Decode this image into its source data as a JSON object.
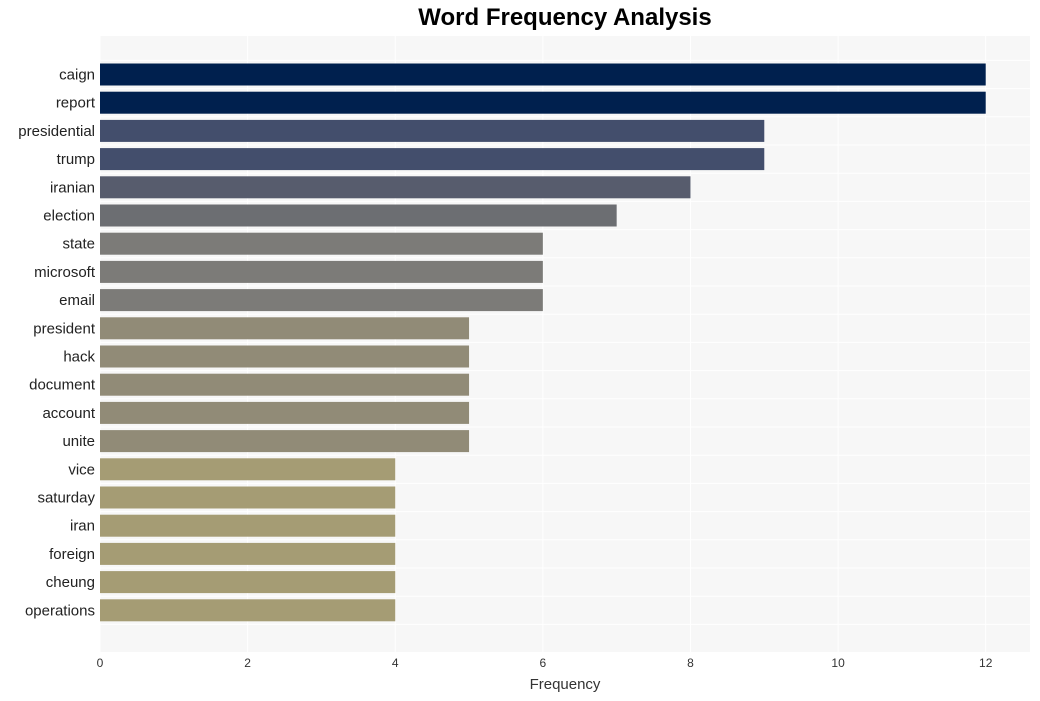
{
  "chart_data": {
    "type": "bar",
    "orientation": "horizontal",
    "title": "Word Frequency Analysis",
    "xlabel": "Frequency",
    "ylabel": "",
    "xlim": [
      0,
      12.6
    ],
    "xticks": [
      0,
      2,
      4,
      6,
      8,
      10,
      12
    ],
    "grid": true,
    "legend": "none",
    "categories": [
      "caign",
      "report",
      "presidential",
      "trump",
      "iranian",
      "election",
      "state",
      "microsoft",
      "email",
      "president",
      "hack",
      "document",
      "account",
      "unite",
      "vice",
      "saturday",
      "iran",
      "foreign",
      "cheung",
      "operations"
    ],
    "values": [
      12,
      12,
      9,
      9,
      8,
      7,
      6,
      6,
      6,
      5,
      5,
      5,
      5,
      5,
      4,
      4,
      4,
      4,
      4,
      4
    ],
    "colors": [
      "#00204e",
      "#00204e",
      "#434e6c",
      "#434e6c",
      "#575c6d",
      "#6c6e72",
      "#7c7b78",
      "#7c7b78",
      "#7c7b78",
      "#918b77",
      "#918b77",
      "#918b77",
      "#918b77",
      "#918b77",
      "#a59c74",
      "#a59c74",
      "#a59c74",
      "#a59c74",
      "#a59c74",
      "#a59c74"
    ]
  }
}
